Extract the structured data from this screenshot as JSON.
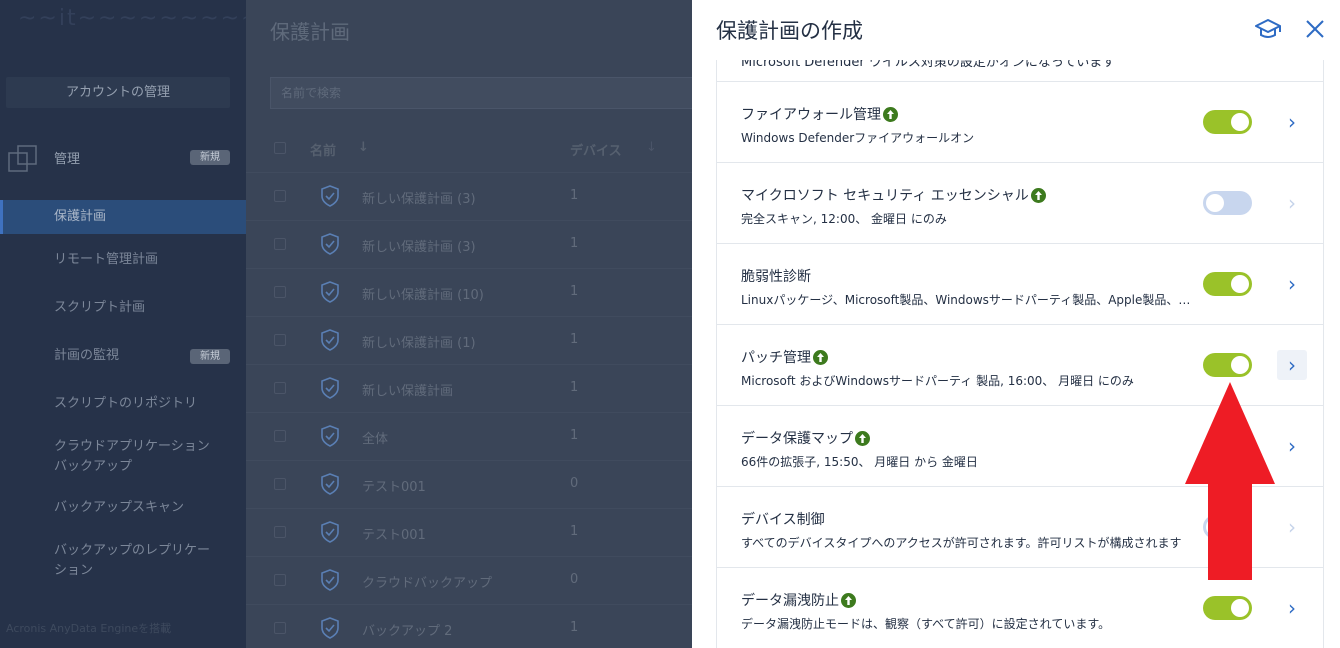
{
  "sidebar": {
    "logo_text": "~~it~~~~~~~~~~",
    "account_button": "アカウントの管理",
    "management_label": "管理",
    "management_badge": "新規",
    "items": [
      {
        "label": "保護計画",
        "active": true
      },
      {
        "label": "リモート管理計画"
      },
      {
        "label": "スクリプト計画"
      },
      {
        "label": "計画の監視",
        "badge": "新規"
      },
      {
        "label": "スクリプトのリポジトリ"
      },
      {
        "label": "クラウドアプリケーション\nバックアップ"
      },
      {
        "label": "バックアップスキャン"
      },
      {
        "label": "バックアップのレプリケー\nション"
      }
    ],
    "footer": "Acronis AnyData Engineを搭載"
  },
  "middle": {
    "title": "保護計画",
    "search_placeholder": "名前で検索",
    "col_name": "名前",
    "col_name_sort": "↓",
    "col_devices": "デバイス",
    "col_devices_sort": "↓",
    "rows": [
      {
        "name": "新しい保護計画 (3)",
        "devices": "1"
      },
      {
        "name": "新しい保護計画 (3)",
        "devices": "1"
      },
      {
        "name": "新しい保護計画 (10)",
        "devices": "1"
      },
      {
        "name": "新しい保護計画 (1)",
        "devices": "1"
      },
      {
        "name": "新しい保護計画",
        "devices": "1"
      },
      {
        "name": "全体",
        "devices": "1"
      },
      {
        "name": "テスト001",
        "devices": "0"
      },
      {
        "name": "テスト001",
        "devices": "1"
      },
      {
        "name": "クラウドバックアップ",
        "devices": "0"
      },
      {
        "name": "バックアップ 2",
        "devices": "1"
      }
    ]
  },
  "panel": {
    "title": "保護計画の作成",
    "cut_text": "Microsoft Defender ウイルス対策の設定がオンになっています",
    "items": [
      {
        "title": "ファイアウォール管理",
        "upgrade": true,
        "subtitle": "Windows Defenderファイアウォールオン",
        "enabled": true,
        "chevron": "normal"
      },
      {
        "title": "マイクロソフト セキュリティ エッセンシャル",
        "upgrade": true,
        "subtitle": "完全スキャン, 12:00、 金曜日 にのみ",
        "enabled": false,
        "chevron": "disabled"
      },
      {
        "title": "脆弱性診断",
        "upgrade": false,
        "subtitle": "Linuxパッケージ、Microsoft製品、Windowsサードパーティ製品、Apple製品、macOSサードパーティ製品",
        "enabled": true,
        "chevron": "normal"
      },
      {
        "title": "パッチ管理",
        "upgrade": true,
        "subtitle": "Microsoft およびWindowsサードパーティ 製品, 16:00、 月曜日 にのみ",
        "enabled": true,
        "chevron": "focus"
      },
      {
        "title": "データ保護マップ",
        "upgrade": true,
        "subtitle": "66件の拡張子, 15:50、 月曜日 から 金曜日",
        "enabled": true,
        "chevron": "normal"
      },
      {
        "title": "デバイス制御",
        "upgrade": false,
        "subtitle": "すべてのデバイスタイプへのアクセスが許可されます。許可リストが構成されます",
        "enabled": false,
        "chevron": "disabled"
      },
      {
        "title": "データ漏洩防止",
        "upgrade": true,
        "subtitle": "データ漏洩防止モードは、観察（すべて許可）に設定されています。",
        "enabled": true,
        "chevron": "normal"
      }
    ]
  },
  "colors": {
    "toggle_on": "#9ac229",
    "toggle_off": "#c8d6ee",
    "accent_blue": "#2e6bc4",
    "upgrade_green": "#3d7a1e",
    "annotation_red": "#ee1c25"
  }
}
